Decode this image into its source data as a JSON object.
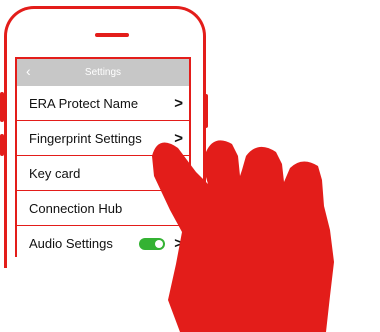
{
  "nav": {
    "title": "Settings",
    "back_icon": "chevron-left-icon"
  },
  "settings": [
    {
      "label": "ERA Protect Name",
      "chevron": ">"
    },
    {
      "label": "Fingerprint Settings",
      "chevron": ">"
    },
    {
      "label": "Key card",
      "chevron": ">"
    },
    {
      "label": "Connection Hub",
      "chevron": ">"
    },
    {
      "label": "Audio Settings",
      "chevron": ">",
      "toggle_on": true
    }
  ],
  "colors": {
    "accent": "#e31d1a",
    "nav_bg": "#c7c7c7",
    "toggle_on": "#34b233"
  }
}
